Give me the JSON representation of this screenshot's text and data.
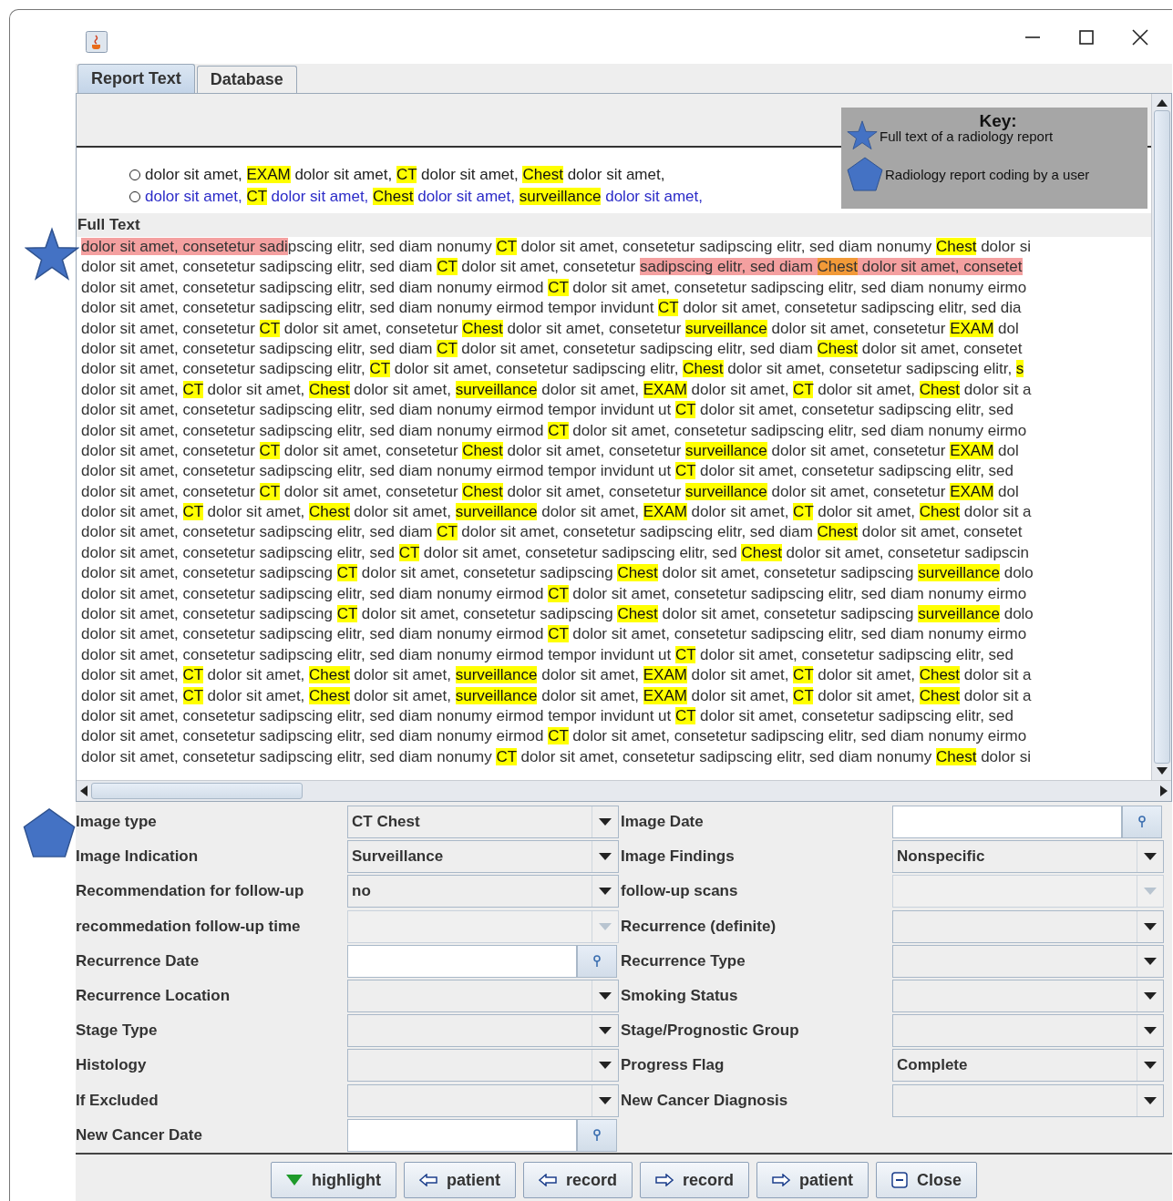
{
  "tabs": [
    {
      "label": "Report Text",
      "selected": true
    },
    {
      "label": "Database",
      "selected": false
    }
  ],
  "summary": {
    "rows": [
      {
        "selected": false,
        "color": "#222222",
        "segments": [
          {
            "text": "dolor sit amet, ",
            "kind": "none"
          },
          {
            "text": "EXAM",
            "kind": "term"
          },
          {
            "text": " dolor sit amet, ",
            "kind": "none"
          },
          {
            "text": "CT",
            "kind": "term"
          },
          {
            "text": " dolor sit amet, ",
            "kind": "none"
          },
          {
            "text": "Chest",
            "kind": "term"
          },
          {
            "text": " dolor sit amet,",
            "kind": "none"
          }
        ]
      },
      {
        "selected": false,
        "color": "#2b2bc8",
        "segments": [
          {
            "text": "dolor sit amet, ",
            "kind": "none"
          },
          {
            "text": "CT",
            "kind": "term"
          },
          {
            "text": " dolor sit amet, ",
            "kind": "none"
          },
          {
            "text": "Chest",
            "kind": "term"
          },
          {
            "text": " dolor sit amet, ",
            "kind": "none"
          },
          {
            "text": "surveillance",
            "kind": "term"
          },
          {
            "text": " dolor sit amet,",
            "kind": "none"
          }
        ]
      }
    ]
  },
  "key": {
    "title": "Key:",
    "items": [
      {
        "kind": "star",
        "label": "Full text of a radiology report"
      },
      {
        "kind": "pentagon",
        "label": "Radiology report coding by a user"
      }
    ]
  },
  "full_text": {
    "heading": "Full Text",
    "lines": [
      [
        {
          "text": "dolor sit amet, consetetur sadi",
          "kind": "selection"
        },
        {
          "text": "pscing elitr, sed diam nonumy ",
          "kind": "none"
        },
        {
          "text": "CT",
          "kind": "term"
        },
        {
          "text": " dolor sit amet, consetetur sadipscing elitr, sed diam nonumy ",
          "kind": "none"
        },
        {
          "text": "Chest",
          "kind": "term"
        },
        {
          "text": " dolor si",
          "kind": "none"
        }
      ],
      [
        {
          "text": "dolor sit amet, consetetur sadipscing elitr, sed diam ",
          "kind": "none"
        },
        {
          "text": "CT",
          "kind": "term"
        },
        {
          "text": " dolor sit amet, consetetur ",
          "kind": "none"
        },
        {
          "text": "sadipscing elitr, sed diam ",
          "kind": "selection"
        },
        {
          "text": "Chest",
          "kind": "term_in_selection"
        },
        {
          "text": " dolor sit amet, consetet",
          "kind": "selection"
        }
      ],
      [
        {
          "text": "dolor sit amet, consetetur sadipscing elitr, sed diam nonumy eirmod ",
          "kind": "none"
        },
        {
          "text": "CT",
          "kind": "term"
        },
        {
          "text": " dolor sit amet, consetetur sadipscing elitr, sed diam nonumy eirmo",
          "kind": "none"
        }
      ],
      [
        {
          "text": "dolor sit amet, consetetur sadipscing elitr, sed diam nonumy eirmod tempor invidunt ",
          "kind": "none"
        },
        {
          "text": "CT",
          "kind": "term"
        },
        {
          "text": " dolor sit amet, consetetur sadipscing elitr, sed dia",
          "kind": "none"
        }
      ],
      [
        {
          "text": "dolor sit amet, consetetur ",
          "kind": "none"
        },
        {
          "text": "CT",
          "kind": "term"
        },
        {
          "text": " dolor sit amet, consetetur ",
          "kind": "none"
        },
        {
          "text": "Chest",
          "kind": "term"
        },
        {
          "text": " dolor sit amet, consetetur ",
          "kind": "none"
        },
        {
          "text": "surveillance",
          "kind": "term"
        },
        {
          "text": " dolor sit amet, consetetur ",
          "kind": "none"
        },
        {
          "text": "EXAM",
          "kind": "term"
        },
        {
          "text": " dol",
          "kind": "none"
        }
      ],
      [
        {
          "text": "dolor sit amet, consetetur sadipscing elitr, sed diam ",
          "kind": "none"
        },
        {
          "text": "CT",
          "kind": "term"
        },
        {
          "text": " dolor sit amet, consetetur sadipscing elitr, sed diam ",
          "kind": "none"
        },
        {
          "text": "Chest",
          "kind": "term"
        },
        {
          "text": " dolor sit amet, consetet",
          "kind": "none"
        }
      ],
      [
        {
          "text": "dolor sit amet, consetetur sadipscing elitr, ",
          "kind": "none"
        },
        {
          "text": "CT",
          "kind": "term"
        },
        {
          "text": " dolor sit amet, consetetur sadipscing elitr, ",
          "kind": "none"
        },
        {
          "text": "Chest",
          "kind": "term"
        },
        {
          "text": " dolor sit amet, consetetur sadipscing elitr, ",
          "kind": "none"
        },
        {
          "text": "s",
          "kind": "term"
        }
      ],
      [
        {
          "text": "dolor sit amet, ",
          "kind": "none"
        },
        {
          "text": "CT",
          "kind": "term"
        },
        {
          "text": " dolor sit amet, ",
          "kind": "none"
        },
        {
          "text": "Chest",
          "kind": "term"
        },
        {
          "text": " dolor sit amet, ",
          "kind": "none"
        },
        {
          "text": "surveillance",
          "kind": "term"
        },
        {
          "text": " dolor sit amet, ",
          "kind": "none"
        },
        {
          "text": "EXAM",
          "kind": "term"
        },
        {
          "text": " dolor sit amet, ",
          "kind": "none"
        },
        {
          "text": "CT",
          "kind": "term"
        },
        {
          "text": " dolor sit amet, ",
          "kind": "none"
        },
        {
          "text": "Chest",
          "kind": "term"
        },
        {
          "text": " dolor sit a",
          "kind": "none"
        }
      ],
      [
        {
          "text": "dolor sit amet, consetetur sadipscing elitr, sed diam nonumy eirmod tempor invidunt ut ",
          "kind": "none"
        },
        {
          "text": "CT",
          "kind": "term"
        },
        {
          "text": " dolor sit amet, consetetur sadipscing elitr, sed",
          "kind": "none"
        }
      ],
      [
        {
          "text": "dolor sit amet, consetetur sadipscing elitr, sed diam nonumy eirmod ",
          "kind": "none"
        },
        {
          "text": "CT",
          "kind": "term"
        },
        {
          "text": " dolor sit amet, consetetur sadipscing elitr, sed diam nonumy eirmo",
          "kind": "none"
        }
      ],
      [
        {
          "text": "dolor sit amet, consetetur ",
          "kind": "none"
        },
        {
          "text": "CT",
          "kind": "term"
        },
        {
          "text": " dolor sit amet, consetetur ",
          "kind": "none"
        },
        {
          "text": "Chest",
          "kind": "term"
        },
        {
          "text": " dolor sit amet, consetetur ",
          "kind": "none"
        },
        {
          "text": "surveillance",
          "kind": "term"
        },
        {
          "text": " dolor sit amet, consetetur ",
          "kind": "none"
        },
        {
          "text": "EXAM",
          "kind": "term"
        },
        {
          "text": " dol",
          "kind": "none"
        }
      ],
      [
        {
          "text": "dolor sit amet, consetetur sadipscing elitr, sed diam nonumy eirmod tempor invidunt ut ",
          "kind": "none"
        },
        {
          "text": "CT",
          "kind": "term"
        },
        {
          "text": " dolor sit amet, consetetur sadipscing elitr, sed",
          "kind": "none"
        }
      ],
      [
        {
          "text": "dolor sit amet, consetetur ",
          "kind": "none"
        },
        {
          "text": "CT",
          "kind": "term"
        },
        {
          "text": " dolor sit amet, consetetur ",
          "kind": "none"
        },
        {
          "text": "Chest",
          "kind": "term"
        },
        {
          "text": " dolor sit amet, consetetur ",
          "kind": "none"
        },
        {
          "text": "surveillance",
          "kind": "term"
        },
        {
          "text": " dolor sit amet, consetetur ",
          "kind": "none"
        },
        {
          "text": "EXAM",
          "kind": "term"
        },
        {
          "text": " dol",
          "kind": "none"
        }
      ],
      [
        {
          "text": "dolor sit amet, ",
          "kind": "none"
        },
        {
          "text": "CT",
          "kind": "term"
        },
        {
          "text": " dolor sit amet, ",
          "kind": "none"
        },
        {
          "text": "Chest",
          "kind": "term"
        },
        {
          "text": " dolor sit amet, ",
          "kind": "none"
        },
        {
          "text": "surveillance",
          "kind": "term"
        },
        {
          "text": " dolor sit amet, ",
          "kind": "none"
        },
        {
          "text": "EXAM",
          "kind": "term"
        },
        {
          "text": " dolor sit amet, ",
          "kind": "none"
        },
        {
          "text": "CT",
          "kind": "term"
        },
        {
          "text": " dolor sit amet, ",
          "kind": "none"
        },
        {
          "text": "Chest",
          "kind": "term"
        },
        {
          "text": " dolor sit a",
          "kind": "none"
        }
      ],
      [
        {
          "text": "dolor sit amet, consetetur sadipscing elitr, sed diam ",
          "kind": "none"
        },
        {
          "text": "CT",
          "kind": "term"
        },
        {
          "text": " dolor sit amet, consetetur sadipscing elitr, sed diam ",
          "kind": "none"
        },
        {
          "text": "Chest",
          "kind": "term"
        },
        {
          "text": " dolor sit amet, consetet",
          "kind": "none"
        }
      ],
      [
        {
          "text": "dolor sit amet, consetetur sadipscing elitr, sed ",
          "kind": "none"
        },
        {
          "text": "CT",
          "kind": "term"
        },
        {
          "text": " dolor sit amet, consetetur sadipscing elitr, sed ",
          "kind": "none"
        },
        {
          "text": "Chest",
          "kind": "term"
        },
        {
          "text": " dolor sit amet, consetetur sadipscin",
          "kind": "none"
        }
      ],
      [
        {
          "text": "dolor sit amet, consetetur sadipscing ",
          "kind": "none"
        },
        {
          "text": "CT",
          "kind": "term"
        },
        {
          "text": " dolor sit amet, consetetur sadipscing ",
          "kind": "none"
        },
        {
          "text": "Chest",
          "kind": "term"
        },
        {
          "text": " dolor sit amet, consetetur sadipscing ",
          "kind": "none"
        },
        {
          "text": "surveillance",
          "kind": "term"
        },
        {
          "text": " dolo",
          "kind": "none"
        }
      ],
      [
        {
          "text": "dolor sit amet, consetetur sadipscing elitr, sed diam nonumy eirmod ",
          "kind": "none"
        },
        {
          "text": "CT",
          "kind": "term"
        },
        {
          "text": " dolor sit amet, consetetur sadipscing elitr, sed diam nonumy eirmo",
          "kind": "none"
        }
      ],
      [
        {
          "text": "dolor sit amet, consetetur sadipscing ",
          "kind": "none"
        },
        {
          "text": "CT",
          "kind": "term"
        },
        {
          "text": " dolor sit amet, consetetur sadipscing ",
          "kind": "none"
        },
        {
          "text": "Chest",
          "kind": "term"
        },
        {
          "text": " dolor sit amet, consetetur sadipscing ",
          "kind": "none"
        },
        {
          "text": "surveillance",
          "kind": "term"
        },
        {
          "text": " dolo",
          "kind": "none"
        }
      ],
      [
        {
          "text": "dolor sit amet, consetetur sadipscing elitr, sed diam nonumy eirmod ",
          "kind": "none"
        },
        {
          "text": "CT",
          "kind": "term"
        },
        {
          "text": " dolor sit amet, consetetur sadipscing elitr, sed diam nonumy eirmo",
          "kind": "none"
        }
      ],
      [
        {
          "text": "dolor sit amet, consetetur sadipscing elitr, sed diam nonumy eirmod tempor invidunt ut ",
          "kind": "none"
        },
        {
          "text": "CT",
          "kind": "term"
        },
        {
          "text": " dolor sit amet, consetetur sadipscing elitr, sed",
          "kind": "none"
        }
      ],
      [
        {
          "text": "dolor sit amet, ",
          "kind": "none"
        },
        {
          "text": "CT",
          "kind": "term"
        },
        {
          "text": " dolor sit amet, ",
          "kind": "none"
        },
        {
          "text": "Chest",
          "kind": "term"
        },
        {
          "text": " dolor sit amet, ",
          "kind": "none"
        },
        {
          "text": "surveillance",
          "kind": "term"
        },
        {
          "text": " dolor sit amet, ",
          "kind": "none"
        },
        {
          "text": "EXAM",
          "kind": "term"
        },
        {
          "text": " dolor sit amet, ",
          "kind": "none"
        },
        {
          "text": "CT",
          "kind": "term"
        },
        {
          "text": " dolor sit amet, ",
          "kind": "none"
        },
        {
          "text": "Chest",
          "kind": "term"
        },
        {
          "text": " dolor sit a",
          "kind": "none"
        }
      ],
      [
        {
          "text": "dolor sit amet, ",
          "kind": "none"
        },
        {
          "text": "CT",
          "kind": "term"
        },
        {
          "text": " dolor sit amet, ",
          "kind": "none"
        },
        {
          "text": "Chest",
          "kind": "term"
        },
        {
          "text": " dolor sit amet, ",
          "kind": "none"
        },
        {
          "text": "surveillance",
          "kind": "term"
        },
        {
          "text": " dolor sit amet, ",
          "kind": "none"
        },
        {
          "text": "EXAM",
          "kind": "term"
        },
        {
          "text": " dolor sit amet, ",
          "kind": "none"
        },
        {
          "text": "CT",
          "kind": "term"
        },
        {
          "text": " dolor sit amet, ",
          "kind": "none"
        },
        {
          "text": "Chest",
          "kind": "term"
        },
        {
          "text": " dolor sit a",
          "kind": "none"
        }
      ],
      [
        {
          "text": "dolor sit amet, consetetur sadipscing elitr, sed diam nonumy eirmod tempor invidunt ut ",
          "kind": "none"
        },
        {
          "text": "CT",
          "kind": "term"
        },
        {
          "text": " dolor sit amet, consetetur sadipscing elitr, sed",
          "kind": "none"
        }
      ],
      [
        {
          "text": "dolor sit amet, consetetur sadipscing elitr, sed diam nonumy eirmod ",
          "kind": "none"
        },
        {
          "text": "CT",
          "kind": "term"
        },
        {
          "text": " dolor sit amet, consetetur sadipscing elitr, sed diam nonumy eirmo",
          "kind": "none"
        }
      ],
      [
        {
          "text": "dolor sit amet, consetetur sadipscing elitr, sed diam nonumy ",
          "kind": "none"
        },
        {
          "text": "CT",
          "kind": "term"
        },
        {
          "text": " dolor sit amet, consetetur sadipscing elitr, sed diam nonumy ",
          "kind": "none"
        },
        {
          "text": "Chest",
          "kind": "term"
        },
        {
          "text": " dolor si",
          "kind": "none"
        }
      ]
    ]
  },
  "form": {
    "left": [
      {
        "label": "Image type",
        "kind": "combo",
        "value": "CT Chest",
        "disabled": false
      },
      {
        "label": "Image Indication",
        "kind": "combo",
        "value": "Surveillance",
        "disabled": false
      },
      {
        "label": "Recommendation for follow-up",
        "kind": "combo",
        "value": "no",
        "disabled": false
      },
      {
        "label": "recommedation follow-up time",
        "kind": "combo",
        "disabled": true
      },
      {
        "label": "Recurrence Date",
        "kind": "date"
      },
      {
        "label": "Recurrence Location",
        "kind": "combo",
        "disabled": false
      },
      {
        "label": "Stage Type",
        "kind": "combo",
        "disabled": false
      },
      {
        "label": "Histology",
        "kind": "combo",
        "disabled": false
      },
      {
        "label": "If Excluded",
        "kind": "combo",
        "disabled": false
      },
      {
        "label": "New Cancer Date",
        "kind": "date"
      }
    ],
    "right": [
      {
        "label": "Image Date",
        "kind": "date"
      },
      {
        "label": "Image Findings",
        "kind": "combo",
        "value": "Nonspecific",
        "disabled": false
      },
      {
        "label": "follow-up scans",
        "kind": "combo",
        "disabled": true
      },
      {
        "label": "Recurrence (definite)",
        "kind": "combo",
        "disabled": false
      },
      {
        "label": "Recurrence Type",
        "kind": "combo",
        "disabled": false
      },
      {
        "label": "Smoking Status",
        "kind": "combo",
        "disabled": false
      },
      {
        "label": "Stage/Prognostic Group",
        "kind": "combo",
        "disabled": false
      },
      {
        "label": "Progress Flag",
        "kind": "combo",
        "value": "Complete",
        "disabled": false
      },
      {
        "label": "New Cancer Diagnosis",
        "kind": "combo",
        "disabled": false
      }
    ]
  },
  "buttons": [
    {
      "label": "highlight",
      "kind": "triangle"
    },
    {
      "label": "patient",
      "kind": "back"
    },
    {
      "label": "record",
      "kind": "back"
    },
    {
      "label": "record",
      "kind": "forward"
    },
    {
      "label": "patient",
      "kind": "forward"
    },
    {
      "label": "Close",
      "kind": "close"
    }
  ]
}
